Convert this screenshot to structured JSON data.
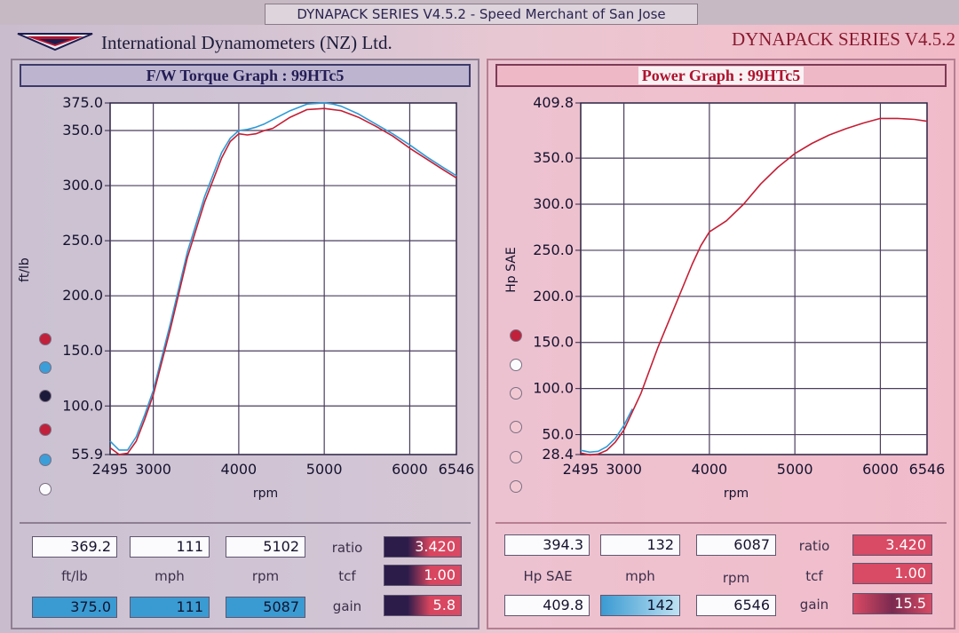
{
  "window": {
    "title": "DYNAPACK SERIES V4.5.2  - Speed Merchant of San Jose"
  },
  "header": {
    "company": "International Dynamometers (NZ) Ltd.",
    "series": "DYNAPACK SERIES V4.5.2"
  },
  "colors": {
    "run_red": "#c41e34",
    "run_blue": "#2f9ad6",
    "grid": "#4a3d5e"
  },
  "torque": {
    "title": "F/W Torque Graph : 99HTc5",
    "readout": {
      "value1": "369.2",
      "value2": "111",
      "value3": "5102",
      "label1": "ft/lb",
      "label2": "mph",
      "label3": "rpm",
      "value4": "375.0",
      "value5": "111",
      "value6": "5087",
      "ratio_label": "ratio",
      "ratio": "3.420",
      "tcf_label": "tcf",
      "tcf": "1.00",
      "gain_label": "gain",
      "gain": "5.8"
    }
  },
  "power": {
    "title": "Power Graph : 99HTc5",
    "readout": {
      "value1": "394.3",
      "value2": "132",
      "value3": "6087",
      "label1": "Hp SAE",
      "label2": "mph",
      "label3": "rpm",
      "value4": "409.8",
      "value5": "142",
      "value6": "6546",
      "ratio_label": "ratio",
      "ratio": "3.420",
      "tcf_label": "tcf",
      "tcf": "1.00",
      "gain_label": "gain",
      "gain": "15.5"
    }
  },
  "chart_data": [
    {
      "type": "line",
      "title": "F/W Torque Graph : 99HTc5",
      "xlabel": "rpm",
      "ylabel": "ft/lb",
      "xlim": [
        2495,
        6546
      ],
      "ylim": [
        55.9,
        375.0
      ],
      "x_ticks": [
        2495,
        3000,
        4000,
        5000,
        6000,
        6546
      ],
      "y_ticks": [
        55.9,
        100.0,
        150.0,
        200.0,
        250.0,
        300.0,
        350.0,
        375.0
      ],
      "x_gridlines": [
        3000,
        4000,
        5000,
        6000
      ],
      "y_gridlines": [
        100,
        150,
        200,
        250,
        300,
        350
      ],
      "grid": true,
      "series": [
        {
          "color": "#c41e34",
          "x": [
            2495,
            2600,
            2700,
            2800,
            2900,
            3000,
            3200,
            3400,
            3600,
            3800,
            3900,
            4000,
            4100,
            4200,
            4300,
            4400,
            4600,
            4800,
            5000,
            5100,
            5200,
            5400,
            5600,
            5800,
            6000,
            6200,
            6400,
            6546
          ],
          "y": [
            62,
            56,
            57,
            68,
            88,
            110,
            170,
            235,
            285,
            325,
            340,
            347,
            346,
            347,
            350,
            352,
            362,
            369,
            370,
            369,
            368,
            362,
            354,
            345,
            334,
            324,
            314,
            307
          ]
        },
        {
          "color": "#2f9ad6",
          "x": [
            2495,
            2600,
            2700,
            2800,
            2900,
            3000,
            3200,
            3400,
            3600,
            3800,
            3900,
            4000,
            4100,
            4200,
            4300,
            4400,
            4600,
            4800,
            5000,
            5100,
            5200,
            5400,
            5600,
            5800,
            6000,
            6200,
            6400,
            6546
          ],
          "y": [
            68,
            60,
            60,
            72,
            92,
            114,
            175,
            240,
            290,
            330,
            343,
            350,
            351,
            353,
            356,
            360,
            368,
            374,
            375,
            374,
            372,
            365,
            356,
            347,
            337,
            326,
            316,
            309
          ]
        }
      ]
    },
    {
      "type": "line",
      "title": "Power Graph : 99HTc5",
      "xlabel": "rpm",
      "ylabel": "Hp SAE",
      "xlim": [
        2495,
        6546
      ],
      "ylim": [
        28.4,
        409.8
      ],
      "x_ticks": [
        2495,
        3000,
        4000,
        5000,
        6000,
        6546
      ],
      "y_ticks": [
        28.4,
        50.0,
        100.0,
        150.0,
        200.0,
        250.0,
        300.0,
        350.0,
        409.8
      ],
      "x_gridlines": [
        3000,
        4000,
        5000,
        6000
      ],
      "y_gridlines": [
        50,
        100,
        150,
        200,
        250,
        300,
        350
      ],
      "grid": true,
      "series": [
        {
          "color": "#c41e34",
          "x": [
            2495,
            2600,
            2700,
            2800,
            2900,
            3000,
            3200,
            3400,
            3600,
            3800,
            3900,
            4000,
            4200,
            4400,
            4600,
            4800,
            5000,
            5200,
            5400,
            5600,
            5800,
            6000,
            6200,
            6400,
            6546
          ],
          "y": [
            30,
            28,
            29,
            33,
            42,
            55,
            95,
            145,
            190,
            235,
            255,
            270,
            282,
            300,
            322,
            340,
            355,
            366,
            375,
            382,
            388,
            393,
            393,
            392,
            390
          ]
        },
        {
          "color": "#2f9ad6",
          "x": [
            2495,
            2600,
            2700,
            2800,
            2900,
            3000,
            3100
          ],
          "y": [
            33,
            31,
            32,
            37,
            46,
            60,
            78
          ]
        }
      ]
    }
  ]
}
